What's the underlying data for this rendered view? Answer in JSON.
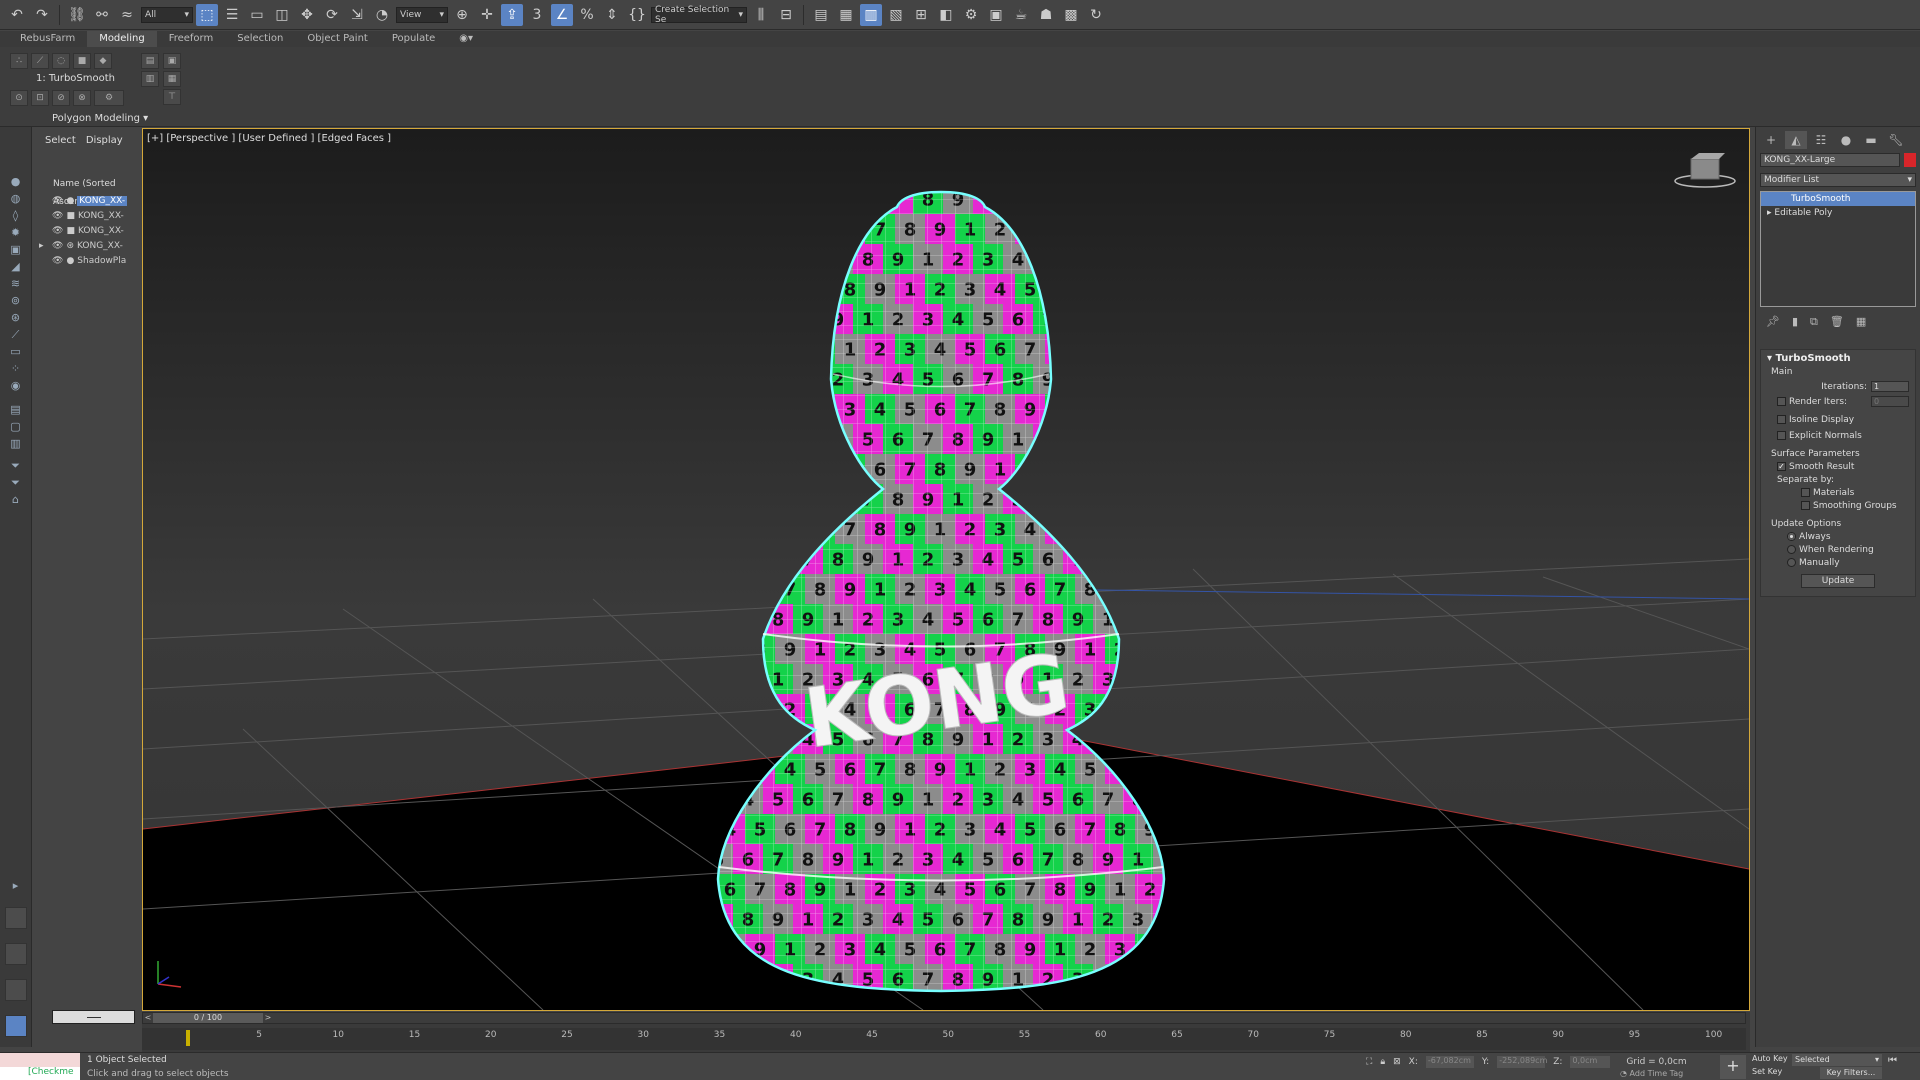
{
  "toolbar": {
    "filter_value": "All",
    "ref_coord_value": "View",
    "selection_set_placeholder": "Create Selection Se"
  },
  "ribbon": {
    "tabs": [
      "RebusFarm",
      "Modeling",
      "Freeform",
      "Selection",
      "Object Paint",
      "Populate"
    ],
    "active_tab": "Modeling",
    "modifier_stack_label": "1: TurboSmooth",
    "group_label": "Polygon Modeling"
  },
  "scene_explorer": {
    "tabs": [
      "Select",
      "Display"
    ],
    "header": "Name (Sorted Ascen",
    "items": [
      "KONG_XX-",
      "KONG_XX-",
      "KONG_XX-",
      "KONG_XX-",
      "ShadowPla"
    ]
  },
  "viewport": {
    "label": "[+] [Perspective ] [User Defined ] [Edged Faces ]",
    "logo_text": "KONG",
    "colors": {
      "red": "#e8222a",
      "yellow": "#f2e40e",
      "green": "#14d24a",
      "cyan": "#34d6e6",
      "blue": "#2858e0",
      "purple": "#8a2ad8",
      "magenta": "#e628d2",
      "gray": "#8c8c8c",
      "white": "#f0f0f0"
    }
  },
  "command_panel": {
    "object_name": "KONG_XX-Large",
    "modifier_list_label": "Modifier List",
    "stack": [
      "TurboSmooth",
      "Editable Poly"
    ],
    "rollout_title": "TurboSmooth",
    "main_label": "Main",
    "iterations_label": "Iterations:",
    "iterations_value": "1",
    "render_iters_label": "Render Iters:",
    "render_iters_value": "0",
    "isoline_label": "Isoline Display",
    "explicit_normals_label": "Explicit Normals",
    "surface_params_label": "Surface Parameters",
    "smooth_result_label": "Smooth Result",
    "separate_by_label": "Separate by:",
    "materials_label": "Materials",
    "smoothing_groups_label": "Smoothing Groups",
    "update_options_label": "Update Options",
    "always_label": "Always",
    "when_rendering_label": "When Rendering",
    "manually_label": "Manually",
    "update_button": "Update"
  },
  "timeline": {
    "frame_label": "0 / 100",
    "ticks": [
      "5",
      "10",
      "15",
      "20",
      "25",
      "30",
      "35",
      "40",
      "45",
      "50",
      "55",
      "60",
      "65",
      "70",
      "75",
      "80",
      "85",
      "90",
      "95",
      "100"
    ]
  },
  "status": {
    "selection_text": "1 Object Selected",
    "hint_text": "Click and drag to select objects",
    "script_label": "[Checkme",
    "x_label": "X:",
    "x_value": "-67,082cm",
    "y_label": "Y:",
    "y_value": "-252,089cm",
    "z_label": "Z:",
    "z_value": "0,0cm",
    "grid_text": "Grid = 0,0cm",
    "add_time_tag": "Add Time Tag",
    "auto_key": "Auto Key",
    "set_key": "Set Key",
    "key_mode_value": "Selected",
    "key_filters": "Key Filters..."
  }
}
